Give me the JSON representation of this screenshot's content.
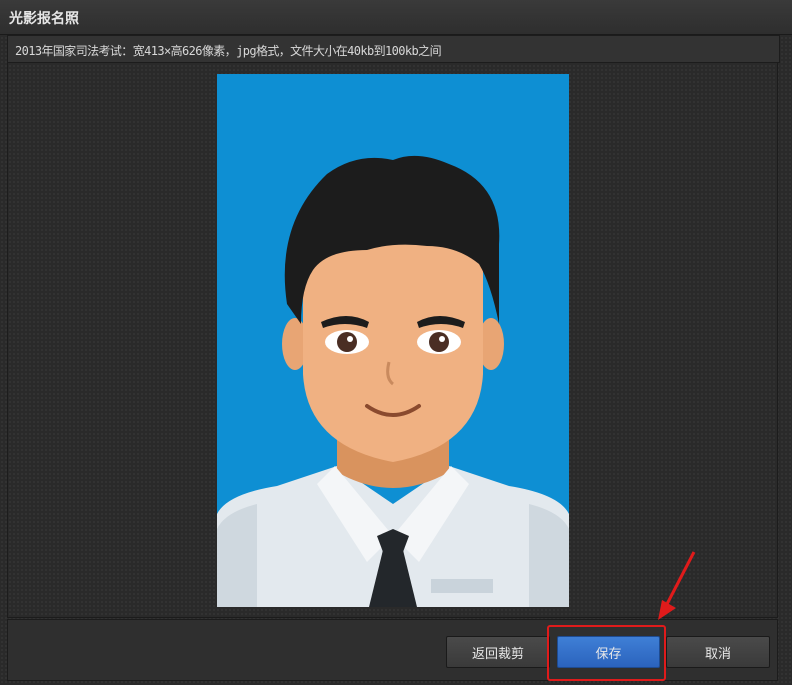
{
  "window": {
    "title": "光影报名照"
  },
  "info": {
    "requirement": "2013年国家司法考试：宽413×高626像素，jpg格式，文件大小在40kb到100kb之间"
  },
  "photo": {
    "background_color": "#0e8fd3",
    "subject": "id-photo-avatar"
  },
  "buttons": {
    "back_crop": "返回裁剪",
    "save": "保存",
    "cancel": "取消"
  },
  "annotation": {
    "highlight_color": "#e01b1b",
    "target": "save-button"
  }
}
